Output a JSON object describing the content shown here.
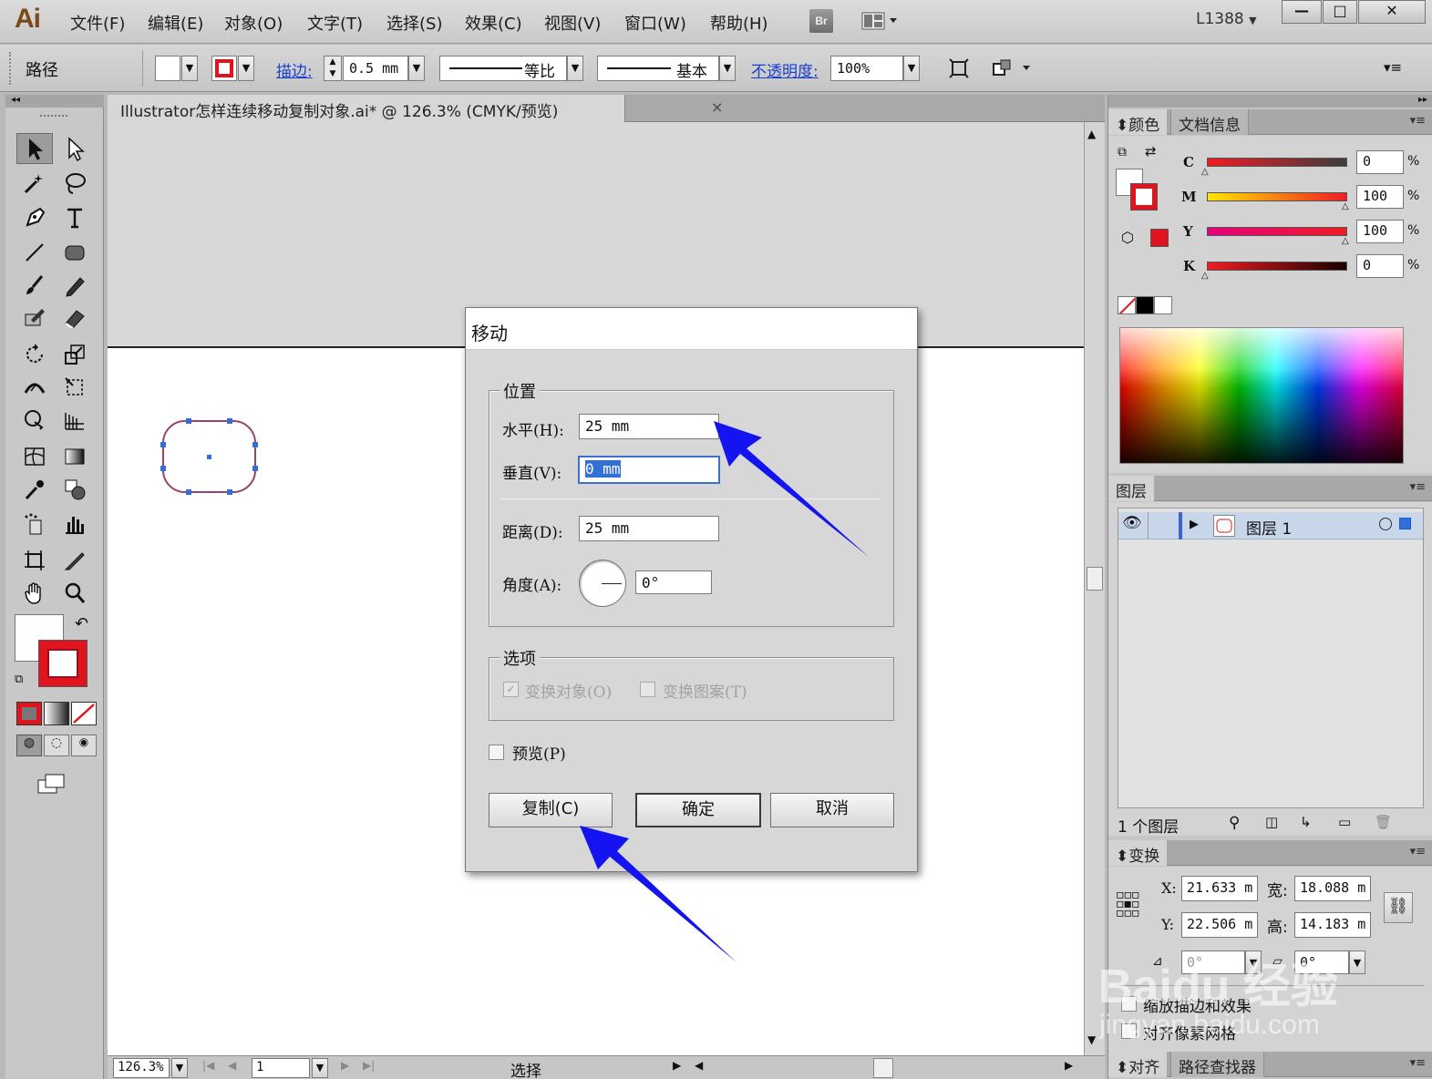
{
  "app": {
    "logo": "Ai",
    "workspace": "L1388",
    "bridge": "Br"
  },
  "menu": [
    "文件(F)",
    "编辑(E)",
    "对象(O)",
    "文字(T)",
    "选择(S)",
    "效果(C)",
    "视图(V)",
    "窗口(W)",
    "帮助(H)"
  ],
  "control": {
    "selection_label": "路径",
    "stroke_label": "描边:",
    "stroke_value": "0.5 mm",
    "profile_label": "等比",
    "brush_label": "基本",
    "opacity_label": "不透明度:",
    "opacity_value": "100%"
  },
  "document": {
    "tab_title": "Illustrator怎样连续移动复制对象.ai* @ 126.3% (CMYK/预览)",
    "close": "×"
  },
  "status": {
    "zoom": "126.3%",
    "page": "1",
    "mode": "选择"
  },
  "dialog": {
    "title": "移动",
    "position_group": "位置",
    "horizontal_label": "水平(H):",
    "horizontal_value": "25 mm",
    "vertical_label": "垂直(V):",
    "vertical_value": "0 mm",
    "distance_label": "距离(D):",
    "distance_value": "25 mm",
    "angle_label": "角度(A):",
    "angle_value": "0°",
    "options_group": "选项",
    "transform_objects": "变换对象(O)",
    "transform_patterns": "变换图案(T)",
    "preview": "预览(P)",
    "copy_button": "复制(C)",
    "ok_button": "确定",
    "cancel_button": "取消"
  },
  "color_panel": {
    "tab_color": "颜色",
    "tab_docinfo": "文档信息",
    "channels": [
      {
        "name": "C",
        "value": "0",
        "pct": "%"
      },
      {
        "name": "M",
        "value": "100",
        "pct": "%"
      },
      {
        "name": "Y",
        "value": "100",
        "pct": "%"
      },
      {
        "name": "K",
        "value": "0",
        "pct": "%"
      }
    ]
  },
  "layers_panel": {
    "tab": "图层",
    "layer_name": "图层 1",
    "count": "1 个图层"
  },
  "transform_panel": {
    "tab": "变换",
    "x_label": "X:",
    "x_value": "21.633 m",
    "w_label": "宽:",
    "w_value": "18.088 m",
    "y_label": "Y:",
    "y_value": "22.506 m",
    "h_label": "高:",
    "h_value": "14.183 m",
    "rotate_value": "0°",
    "shear_value": "0°",
    "scale_strokes": "缩放描边和效果",
    "align_pixel": "对齐像素网格"
  },
  "bottom_panel": {
    "tab_align": "对齐",
    "tab_pathfinder": "路径查找器"
  },
  "watermark": {
    "text": "Baidu 经验",
    "url": "jingyan.baidu.com"
  },
  "colors": {
    "stroke_red": "#e0141e",
    "arrow_blue": "#1414f0",
    "selection_blue": "#2f6fe0",
    "shape_stroke": "#b0384a"
  }
}
